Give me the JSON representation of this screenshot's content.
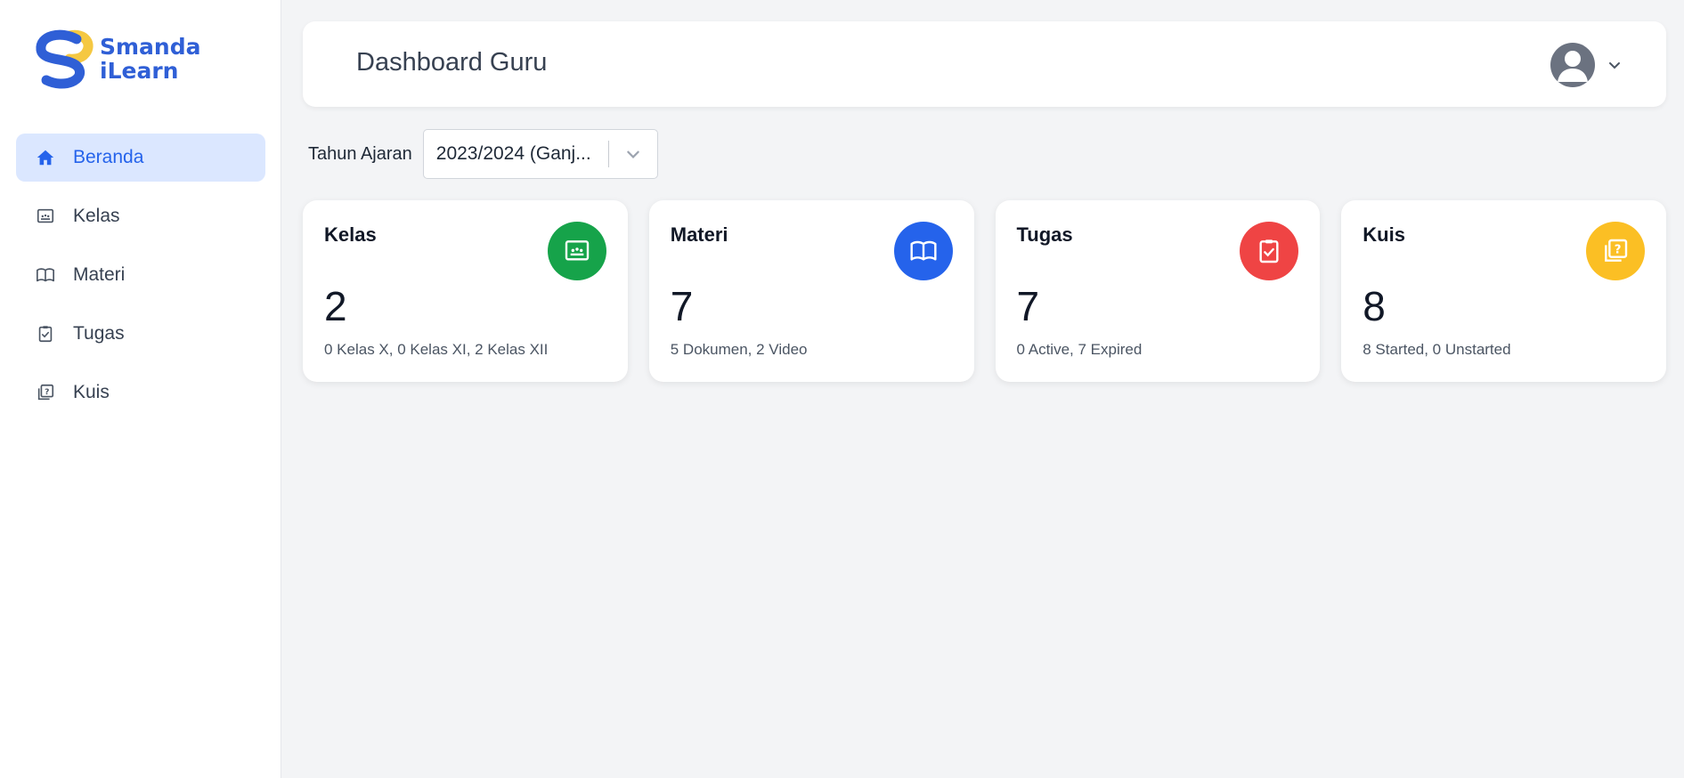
{
  "brand": {
    "line1": "Smanda",
    "line2": "iLearn",
    "primary_color": "#2f5fd6",
    "accent_color": "#f5c842"
  },
  "sidebar": {
    "items": [
      {
        "label": "Beranda",
        "icon": "home-icon",
        "active": true
      },
      {
        "label": "Kelas",
        "icon": "classroom-icon",
        "active": false
      },
      {
        "label": "Materi",
        "icon": "book-icon",
        "active": false
      },
      {
        "label": "Tugas",
        "icon": "clipboard-check-icon",
        "active": false
      },
      {
        "label": "Kuis",
        "icon": "quiz-icon",
        "active": false
      }
    ]
  },
  "header": {
    "title": "Dashboard Guru",
    "avatar_icon": "user-avatar-icon"
  },
  "filter": {
    "label": "Tahun Ajaran",
    "selected": "2023/2024 (Ganj..."
  },
  "cards": [
    {
      "title": "Kelas",
      "value": "2",
      "desc": "0 Kelas X, 0 Kelas XI, 2 Kelas XII",
      "icon": "classroom-icon",
      "color": "#16a34a"
    },
    {
      "title": "Materi",
      "value": "7",
      "desc": "5 Dokumen, 2 Video",
      "icon": "book-icon",
      "color": "#2563eb"
    },
    {
      "title": "Tugas",
      "value": "7",
      "desc": "0 Active, 7 Expired",
      "icon": "clipboard-check-icon",
      "color": "#ef4444"
    },
    {
      "title": "Kuis",
      "value": "8",
      "desc": "8 Started, 0 Unstarted",
      "icon": "quiz-icon",
      "color": "#fbbf24"
    }
  ]
}
